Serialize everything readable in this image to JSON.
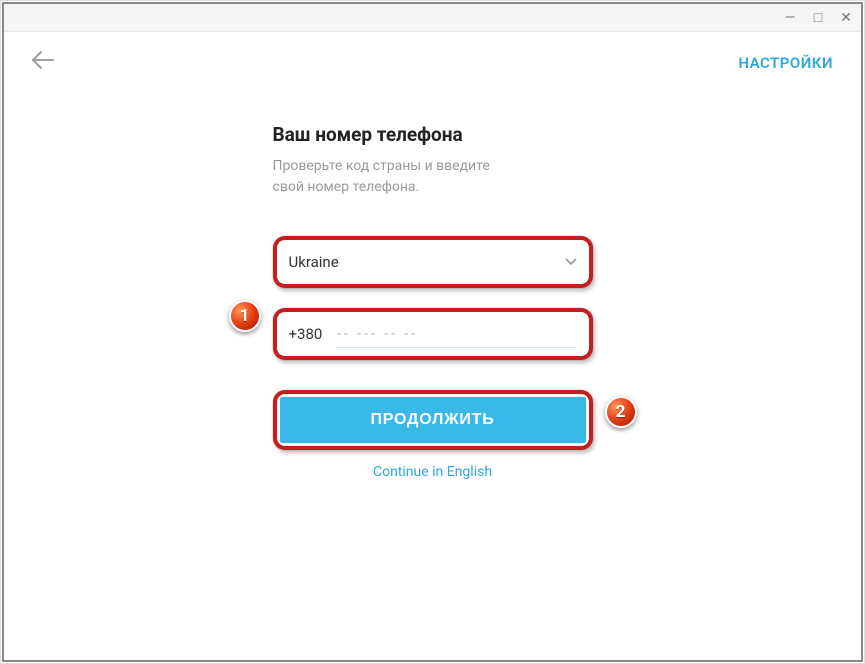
{
  "window": {
    "minimize": "—",
    "maximize": "□",
    "close": "✕"
  },
  "topbar": {
    "settings": "НАСТРОЙКИ"
  },
  "heading": {
    "title": "Ваш номер телефона",
    "subtitle_line1": "Проверьте код страны и введите",
    "subtitle_line2": "свой номер телефона."
  },
  "form": {
    "country": "Ukraine",
    "prefix": "+380",
    "phone_placeholder": "-- --- -- --",
    "phone_value": "",
    "continue_label": "ПРОДОЛЖИТЬ"
  },
  "lang_link": "Continue in English",
  "badges": {
    "one": "1",
    "two": "2"
  }
}
